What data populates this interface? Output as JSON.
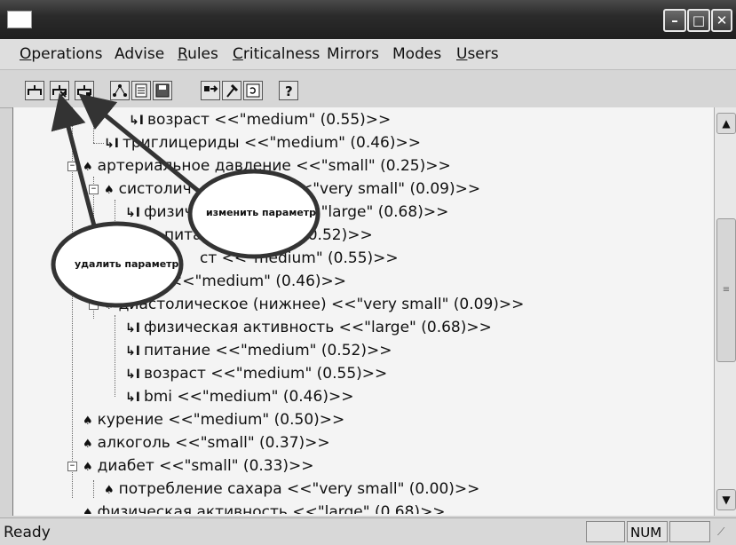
{
  "menu": {
    "items": [
      {
        "label": "Operations",
        "underline": "O",
        "rest": "perations"
      },
      {
        "label": "Advise",
        "underline": "",
        "rest": "Advise"
      },
      {
        "label": "Rules",
        "underline": "R",
        "rest": "ules"
      },
      {
        "label": "Criticalness",
        "underline": "C",
        "rest": "riticalness"
      },
      {
        "label": "Mirrors",
        "underline": "",
        "rest": "Mirrors"
      },
      {
        "label": "Modes",
        "underline": "",
        "rest": "Modes"
      },
      {
        "label": "Users",
        "underline": "U",
        "rest": "sers"
      }
    ]
  },
  "tree": {
    "lines": [
      {
        "text": "возраст <<\"medium\" (0.55)>>"
      },
      {
        "text": "триглицериды <<\"medium\" (0.46)>>"
      },
      {
        "text": "артериальное давление <<\"small\" (0.25)>>"
      },
      {
        "text": "систолич",
        "text2": ") <<\"very small\" (0.09)>>"
      },
      {
        "text": "физич",
        "text2": "ь <<\"large\" (0.68)>>"
      },
      {
        "text": "питание",
        "text2": "(0.52)>>"
      },
      {
        "text": "ст <<\"medium\" (0.55)>>"
      },
      {
        "text": "<<\"medium\" (0.46)>>"
      },
      {
        "text": "диастолическое (нижнее) <<\"very small\" (0.09)>>"
      },
      {
        "text": "физическая активность <<\"large\" (0.68)>>"
      },
      {
        "text": "питание <<\"medium\" (0.52)>>"
      },
      {
        "text": "возраст <<\"medium\" (0.55)>>"
      },
      {
        "text": "bmi <<\"medium\" (0.46)>>"
      },
      {
        "text": "курение <<\"medium\" (0.50)>>"
      },
      {
        "text": "алкоголь <<\"small\" (0.37)>>"
      },
      {
        "text": "диабет <<\"small\" (0.33)>>"
      },
      {
        "text": "потребление сахара <<\"very small\" (0.00)>>"
      },
      {
        "text": "физическая активность <<\"large\" (0.68)>>"
      }
    ]
  },
  "callouts": {
    "edit": "изменить параметр",
    "delete": "удалить параметр"
  },
  "status": {
    "text": "Ready",
    "num": "NUM"
  },
  "toolbar_icons": [
    "add-node-icon",
    "delete-node-icon",
    "edit-node-icon",
    "tree-icon",
    "document-icon",
    "save-icon",
    "link-icon",
    "hammer-icon",
    "refresh-icon",
    "help-icon"
  ]
}
